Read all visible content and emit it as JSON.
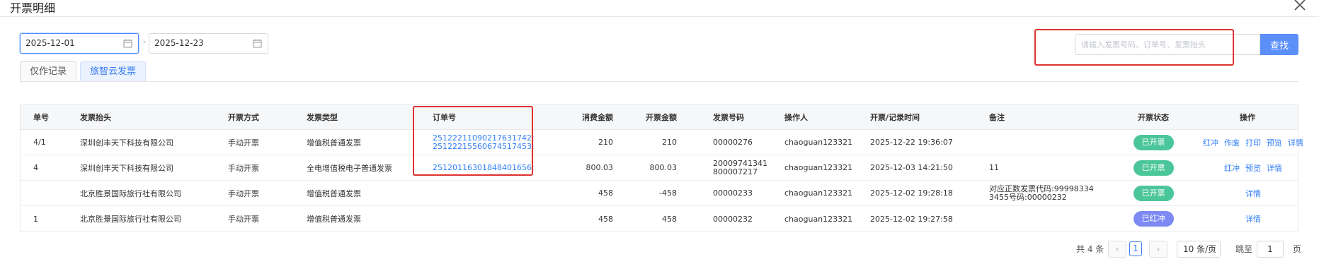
{
  "header": {
    "title": "开票明细"
  },
  "filters": {
    "start_date": "2025-12-01",
    "separator": "-",
    "end_date": "2025-12-23",
    "search_placeholder": "请输入发票号码、订单号、发票抬头",
    "search_label": "查找"
  },
  "tabs": [
    {
      "label": "仅作记录"
    },
    {
      "label": "旅智云发票",
      "active": true
    }
  ],
  "table": {
    "columns": [
      "单号",
      "发票抬头",
      "开票方式",
      "发票类型",
      "订单号",
      "消费金额",
      "开票金额",
      "发票号码",
      "操作人",
      "开票/记录时间",
      "备注",
      "开票状态",
      "操作"
    ],
    "rows": [
      {
        "no": "4/1",
        "title": "深圳创丰天下科技有限公司",
        "method": "手动开票",
        "type": "增值税普通发票",
        "orders": [
          "25122211090217631742;",
          "25122215560674517453;"
        ],
        "consume": "210",
        "amount": "210",
        "invoice_no": "00000276",
        "operator": "chaoguan123321",
        "time": "2025-12-22 19:36:07",
        "note": "",
        "status": "已开票",
        "ops": [
          "红冲",
          "作废",
          "打印",
          "预览",
          "详情"
        ]
      },
      {
        "no": "4",
        "title": "深圳创丰天下科技有限公司",
        "method": "手动开票",
        "type": "全电增值税电子普通发票",
        "orders": [
          "25120116301848401656;"
        ],
        "consume": "800.03",
        "amount": "800.03",
        "invoice_no": "20009741341800007217",
        "operator": "chaoguan123321",
        "time": "2025-12-03 14:21:50",
        "note": "11",
        "status": "已开票",
        "ops": [
          "红冲",
          "预览",
          "详情"
        ]
      },
      {
        "no": "",
        "title": "北京胜景国际旅行社有限公司",
        "method": "手动开票",
        "type": "增值税普通发票",
        "orders": [],
        "consume": "458",
        "amount": "-458",
        "invoice_no": "00000233",
        "operator": "chaoguan123321",
        "time": "2025-12-02 19:28:18",
        "note": "对应正数发票代码:999983343455号码:00000232",
        "status": "已开票",
        "ops": [
          "详情"
        ]
      },
      {
        "no": "1",
        "title": "北京胜景国际旅行社有限公司",
        "method": "手动开票",
        "type": "增值税普通发票",
        "orders": [],
        "consume": "458",
        "amount": "458",
        "invoice_no": "00000232",
        "operator": "chaoguan123321",
        "time": "2025-12-02 19:27:58",
        "note": "",
        "status": "已红冲",
        "ops": [
          "详情"
        ]
      }
    ]
  },
  "pagination": {
    "total_text": "共 4 条",
    "prev_symbol": "‹",
    "next_symbol": "›",
    "current_page": "1",
    "page_size": "10 条/页",
    "size_chevron": "⌄",
    "jump_label": "跳至",
    "jump_value": "1",
    "page_suffix": "页"
  },
  "colors": {
    "accent": "#3a7cf0",
    "search_button": "#5b8ff9",
    "status_issued": "#4bc59a",
    "status_red": "#7d8af3",
    "highlight_box": "#e03131"
  },
  "icons": {
    "close": "close-icon",
    "calendar": "calendar-icon"
  }
}
